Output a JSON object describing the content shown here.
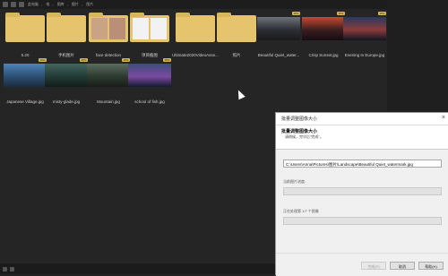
{
  "toolbar": {
    "path": [
      "此电脑",
      "电",
      "图库",
      "图片",
      "图片"
    ],
    "separator": "›"
  },
  "files": [
    {
      "name": "5.20",
      "kind": "folder",
      "badge": ""
    },
    {
      "name": "手机图片",
      "kind": "folder",
      "badge": ""
    },
    {
      "name": "face detection",
      "kind": "folder",
      "badge": ""
    },
    {
      "name": "项目截图",
      "kind": "folder",
      "badge": ""
    },
    {
      "name": "Ultimate2020VideoAsse...",
      "kind": "folder",
      "badge": ""
    },
    {
      "name": "照片",
      "kind": "folder",
      "badge": ""
    },
    {
      "name": "Beautiful Quiet_water...",
      "kind": "image",
      "badge": "JPG",
      "colors": [
        "#6e737a",
        "#2b2e33",
        "#1a1a1c"
      ]
    },
    {
      "name": "Crisp Sunset.jpg",
      "kind": "image",
      "badge": "JPG",
      "colors": [
        "#c84a2a",
        "#3a1e20",
        "#160c10"
      ]
    },
    {
      "name": "Evening In Europe.jpg",
      "kind": "image",
      "badge": "JPG",
      "colors": [
        "#2b3a5e",
        "#8b3b3b",
        "#101522"
      ]
    },
    {
      "name": "Japanese Village.jpg",
      "kind": "image",
      "badge": "JPG",
      "colors": [
        "#4f83b8",
        "#2a4f72",
        "#1b2c3f"
      ]
    },
    {
      "name": "misty-glade.jpg",
      "kind": "image",
      "badge": "JPG",
      "colors": [
        "#41665d",
        "#233a35",
        "#121c1a"
      ]
    },
    {
      "name": "Mountain.jpg",
      "kind": "image",
      "badge": "JPG",
      "colors": [
        "#5b6b5e",
        "#2d3a30",
        "#171d18"
      ]
    },
    {
      "name": "school of fish.jpg",
      "kind": "image",
      "badge": "JPG",
      "colors": [
        "#3c4d7a",
        "#7a4aa0",
        "#141a30"
      ]
    }
  ],
  "dialog": {
    "window_title": "批量调整图像大小",
    "close_icon": "×",
    "heading": "批量调整图像大小",
    "subheading": "请稍候，完毕后\"完成\"。",
    "path_value": "C:\\Users\\Anna\\Pictures\\图片\\Landscape\\Beautiful Quiet_watermark.jpg",
    "current_label": "当前图片进度:",
    "total_label": "正在处理第 1/7 个图像",
    "buttons": {
      "finish": "完成(F)",
      "cancel": "取消",
      "help": "帮助(H)"
    }
  }
}
